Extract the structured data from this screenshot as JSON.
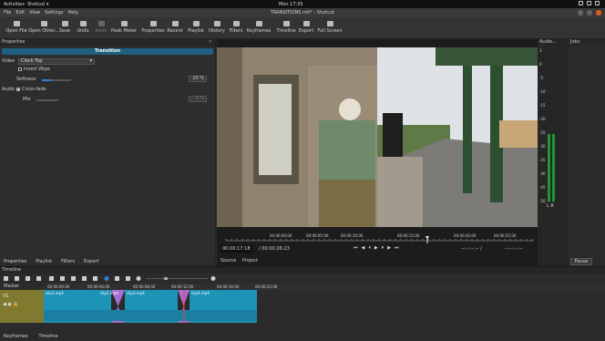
{
  "topbar": {
    "activities": "Activities",
    "app": "Shotcut ▾",
    "clock": "Mon 17:35"
  },
  "window": {
    "title": "TRANSITIONS.mlt* - Shotcut",
    "menu": [
      "File",
      "Edit",
      "View",
      "Settings",
      "Help"
    ]
  },
  "toolbar": {
    "items": [
      "Open File",
      "Open Other...",
      "Save",
      "Undo",
      "Redo",
      "Peak Meter",
      "Properties",
      "Recent",
      "Playlist",
      "History",
      "Filters",
      "Keyframes",
      "Timeline",
      "Export",
      "Full Screen"
    ]
  },
  "properties": {
    "header": "Properties",
    "transition_title": "Transition",
    "video_label": "Video",
    "video_select": "Clock Top",
    "invert_label": "Invert Wipe",
    "softness_label": "Softness",
    "softness_value": "20 %",
    "audio_label": "Audio",
    "crossfade_label": "Cross-fade",
    "mix_label": "Mix",
    "mix_value": "0 %"
  },
  "panel_tabs": [
    "Properties",
    "Playlist",
    "Filters",
    "Export"
  ],
  "player": {
    "ruler_ticks": [
      "00:00:00:00",
      "00:00:05:00",
      "00:00:10:00",
      "00:00:15:00",
      "00:00:20:00",
      "00:00:25:00"
    ],
    "current": "00:00:17:18",
    "total": "/ 00:00:26:23",
    "in": "--:--:--:-- /",
    "out": "--:--:--:--",
    "tabs": [
      "Source",
      "Project"
    ]
  },
  "audio": {
    "header": "Audio...",
    "scale": [
      "3",
      "0",
      "-5",
      "-10",
      "-15",
      "-20",
      "-25",
      "-30",
      "-35",
      "-40",
      "-45",
      "-50"
    ],
    "lr": "L R",
    "level_left": 0.22,
    "level_right": 0.22
  },
  "jobs": {
    "header": "Jobs",
    "pause": "Pause"
  },
  "timeline": {
    "header": "Timeline",
    "master": "Master",
    "track": "V1",
    "ruler": [
      "00:00:00:00",
      "00:00:04:00",
      "00:00:08:00",
      "00:00:12:00",
      "00:00:16:00",
      "00:00:20:00"
    ],
    "clips": [
      "clip1.mp4",
      "clip2.mp4",
      "clip3.mp4",
      "clip4.mp4"
    ]
  },
  "bottom_tabs": [
    "Keyframes",
    "Timeline"
  ],
  "colors": {
    "accent": "#2a82da",
    "clip": "#1e93b8",
    "transition": "#a56ed1",
    "track_header": "#807a30"
  }
}
